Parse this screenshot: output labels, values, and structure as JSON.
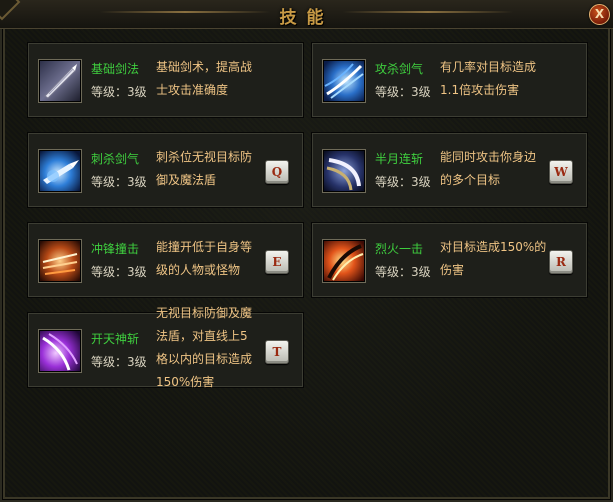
{
  "window": {
    "title": "技能",
    "close_label": "X"
  },
  "skills": [
    {
      "name": "基础剑法",
      "level": "等级：3级",
      "desc_lines": [
        "基础剑术，提高战",
        "士攻击准确度"
      ],
      "hotkey": "",
      "icon": "sword-blade-icon"
    },
    {
      "name": "攻杀剑气",
      "level": "等级：3级",
      "desc_lines": [
        "有几率对目标造成",
        "1.1倍攻击伤害"
      ],
      "hotkey": "",
      "icon": "blue-slash-icon"
    },
    {
      "name": "刺杀剑气",
      "level": "等级：3级",
      "desc_lines": [
        "刺杀位无视目标防",
        "御及魔法盾"
      ],
      "hotkey": "Q",
      "icon": "thrust-icon"
    },
    {
      "name": "半月连斩",
      "level": "等级：3级",
      "desc_lines": [
        "能同时攻击你身边",
        "的多个目标"
      ],
      "hotkey": "W",
      "icon": "half-moon-icon"
    },
    {
      "name": "冲锋撞击",
      "level": "等级：3级",
      "desc_lines": [
        "能撞开低于自身等",
        "级的人物或怪物"
      ],
      "hotkey": "E",
      "icon": "charge-icon"
    },
    {
      "name": "烈火一击",
      "level": "等级：3级",
      "desc_lines": [
        "对目标造成150%的",
        "伤害"
      ],
      "hotkey": "R",
      "icon": "fire-strike-icon"
    },
    {
      "name": "开天神斩",
      "level": "等级：3级",
      "desc_lines": [
        "无视目标防御及魔",
        "法盾，对直线上5",
        "格以内的目标造成",
        "150%伤害"
      ],
      "hotkey": "T",
      "icon": "purple-slash-icon"
    }
  ]
}
